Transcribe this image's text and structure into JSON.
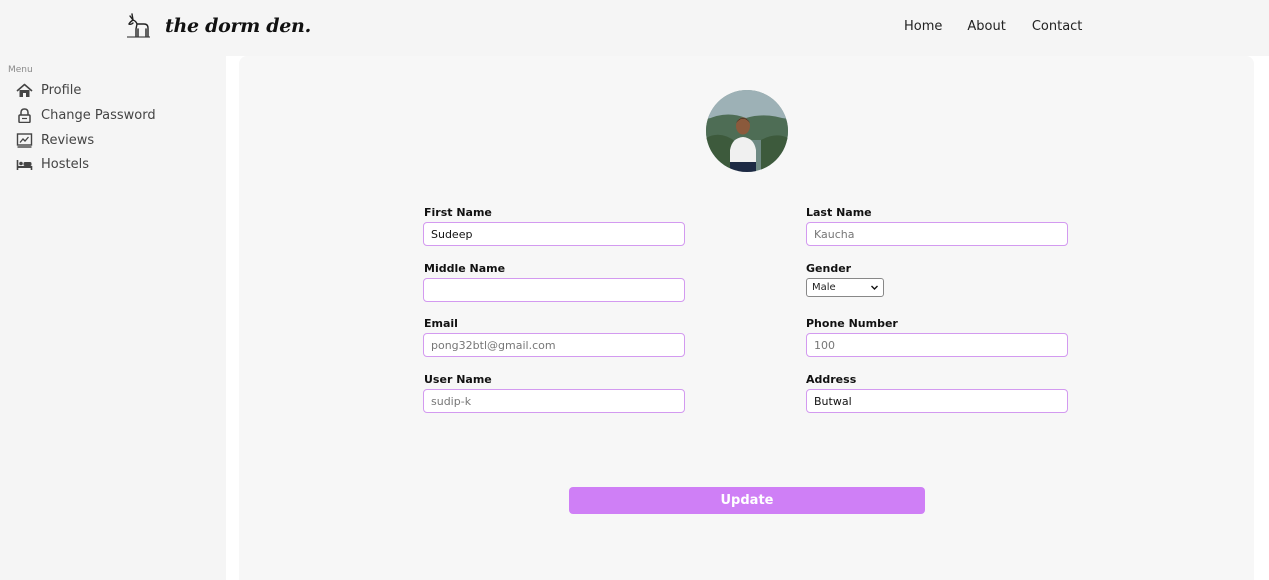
{
  "brand": {
    "name": "the dorm den."
  },
  "nav": {
    "home": "Home",
    "about": "About",
    "contact": "Contact"
  },
  "sidebar": {
    "menu_label": "Menu",
    "items": [
      {
        "label": "Profile",
        "icon": "home-icon"
      },
      {
        "label": "Change Password",
        "icon": "lock-icon"
      },
      {
        "label": "Reviews",
        "icon": "reviews-icon"
      },
      {
        "label": "Hostels",
        "icon": "bed-icon"
      }
    ]
  },
  "form": {
    "first_name": {
      "label": "First Name",
      "value": "Sudeep"
    },
    "last_name": {
      "label": "Last Name",
      "value": "Kaucha"
    },
    "middle_name": {
      "label": "Middle Name",
      "value": ""
    },
    "gender": {
      "label": "Gender",
      "value": "Male"
    },
    "email": {
      "label": "Email",
      "value": "pong32btl@gmail.com"
    },
    "phone": {
      "label": "Phone Number",
      "value": "100"
    },
    "username": {
      "label": "User Name",
      "value": "sudip-k"
    },
    "address": {
      "label": "Address",
      "value": "Butwal"
    },
    "update_label": "Update"
  },
  "colors": {
    "accent": "#cf7ff6",
    "input_border": "#d39af0"
  }
}
